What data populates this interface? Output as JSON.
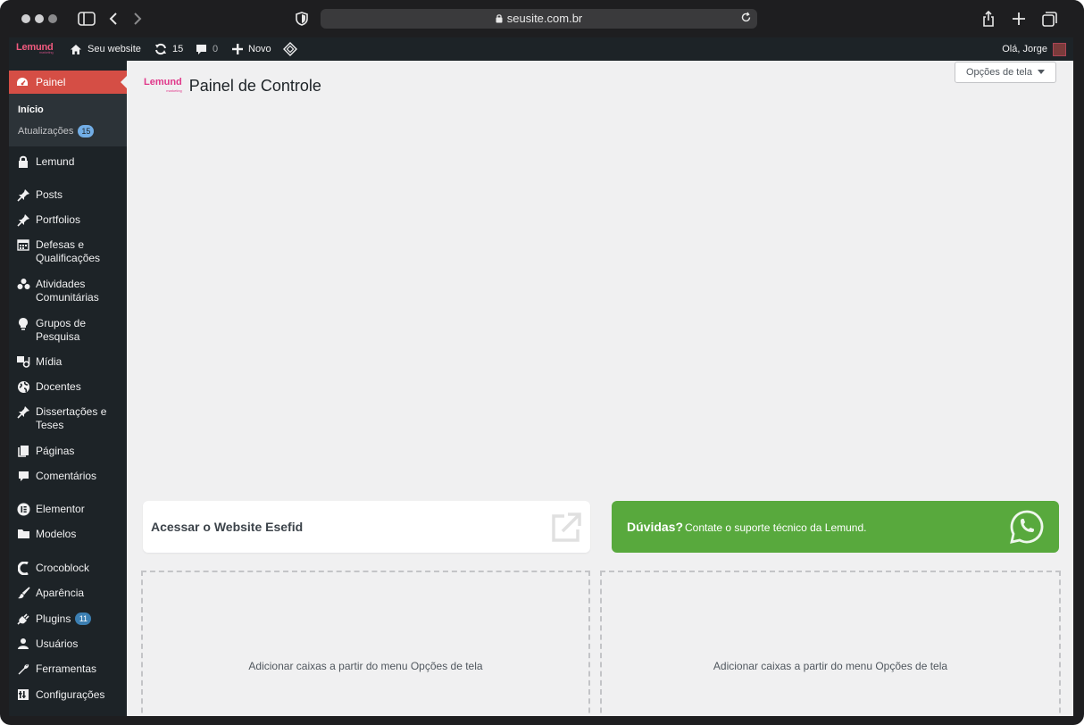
{
  "browser": {
    "url": "seusite.com.br"
  },
  "adminbar": {
    "logo": "Lemund",
    "logo_sub": "marketing",
    "site_name": "Seu website",
    "updates_count": "15",
    "comments_count": "0",
    "new_label": "Novo",
    "greeting": "Olá, Jorge"
  },
  "sidebar": {
    "active": "Painel",
    "submenu": {
      "inicio": "Início",
      "atualizacoes": "Atualizações",
      "atualizacoes_badge": "15"
    },
    "items": [
      {
        "label": "Lemund",
        "icon": "lock-icon"
      },
      {
        "label": "Posts",
        "icon": "pin-icon"
      },
      {
        "label": "Portfolios",
        "icon": "pin-icon"
      },
      {
        "label": "Defesas e Qualificações",
        "icon": "calendar-icon"
      },
      {
        "label": "Atividades Comunitárias",
        "icon": "groups-icon"
      },
      {
        "label": "Grupos de Pesquisa",
        "icon": "lightbulb-icon"
      },
      {
        "label": "Mídia",
        "icon": "media-icon"
      },
      {
        "label": "Docentes",
        "icon": "globe-icon"
      },
      {
        "label": "Dissertações e Teses",
        "icon": "pin-icon"
      },
      {
        "label": "Páginas",
        "icon": "pages-icon"
      },
      {
        "label": "Comentários",
        "icon": "comment-icon"
      },
      {
        "label": "Elementor",
        "icon": "elementor-icon"
      },
      {
        "label": "Modelos",
        "icon": "folder-icon"
      },
      {
        "label": "Crocoblock",
        "icon": "crocoblock-icon"
      },
      {
        "label": "Aparência",
        "icon": "brush-icon"
      },
      {
        "label": "Plugins",
        "icon": "plugin-icon",
        "badge": "11"
      },
      {
        "label": "Usuários",
        "icon": "user-icon"
      },
      {
        "label": "Ferramentas",
        "icon": "wrench-icon"
      },
      {
        "label": "Configurações",
        "icon": "settings-icon"
      }
    ]
  },
  "main": {
    "screen_options": "Opções de tela",
    "logo": "Lemund",
    "logo_sub": "marketing",
    "title": "Painel de Controle",
    "card_access": "Acessar o Website Esefid",
    "support_question": "Dúvidas?",
    "support_text": "Contate o suporte técnico da Lemund.",
    "dropzone_text": "Adicionar caixas a partir do menu Opções de tela"
  },
  "colors": {
    "admin_dark": "#1d2327",
    "active_menu": "#d54e45",
    "support_green": "#58a93d",
    "badge_blue": "#72aee6"
  }
}
